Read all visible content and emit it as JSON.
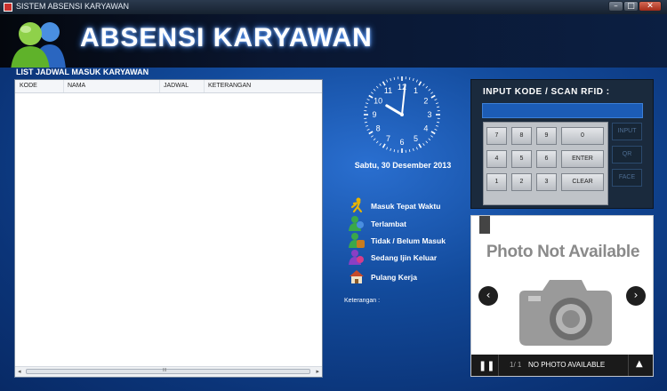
{
  "window": {
    "title": "SISTEM ABSENSI KARYAWAN",
    "btn_min": "–",
    "btn_max": "□",
    "btn_close": "✕"
  },
  "header": {
    "title": "ABSENSI KARYAWAN",
    "logo_icon": "users-icon"
  },
  "schedule": {
    "title": "LIST JADWAL MASUK KARYAWAN",
    "columns": [
      "KODE",
      "NAMA",
      "JADWAL",
      "KETERANGAN"
    ],
    "rows": []
  },
  "clock": {
    "hour": 10,
    "minute": 1,
    "numbers": [
      "12",
      "1",
      "2",
      "3",
      "4",
      "5",
      "6",
      "7",
      "8",
      "9",
      "10",
      "11"
    ]
  },
  "date_text": "Sabtu, 30 Desember 2013",
  "legend": [
    {
      "label": "Masuk Tepat Waktu",
      "icon": "person-running-icon",
      "color": "#e8b400"
    },
    {
      "label": "Terlambat",
      "icon": "user-late-icon",
      "color": "#3aa84a"
    },
    {
      "label": "Tidak / Belum Masuk",
      "icon": "user-absent-icon",
      "color": "#c87b1e"
    },
    {
      "label": "Sedang Ijin Keluar",
      "icon": "user-out-icon",
      "color": "#8a3fc4"
    },
    {
      "label": "Pulang Kerja",
      "icon": "home-icon",
      "color": "#c74a2a"
    }
  ],
  "keterangan_label": "Keterangan :",
  "input_panel": {
    "title": "INPUT KODE / SCAN RFID :",
    "code_value": "",
    "keys": [
      [
        "7",
        "8",
        "9",
        "0"
      ],
      [
        "4",
        "5",
        "6",
        "ENTER"
      ],
      [
        "1",
        "2",
        "3",
        "CLEAR"
      ]
    ],
    "side_buttons": [
      "INPUT",
      "QR",
      "FACE"
    ]
  },
  "photo": {
    "placeholder": "Photo Not Available",
    "prev": "‹",
    "next": "›",
    "pause": "❚❚",
    "count": "1/ 1",
    "status": "NO PHOTO AVAILABLE",
    "up": "▲"
  }
}
